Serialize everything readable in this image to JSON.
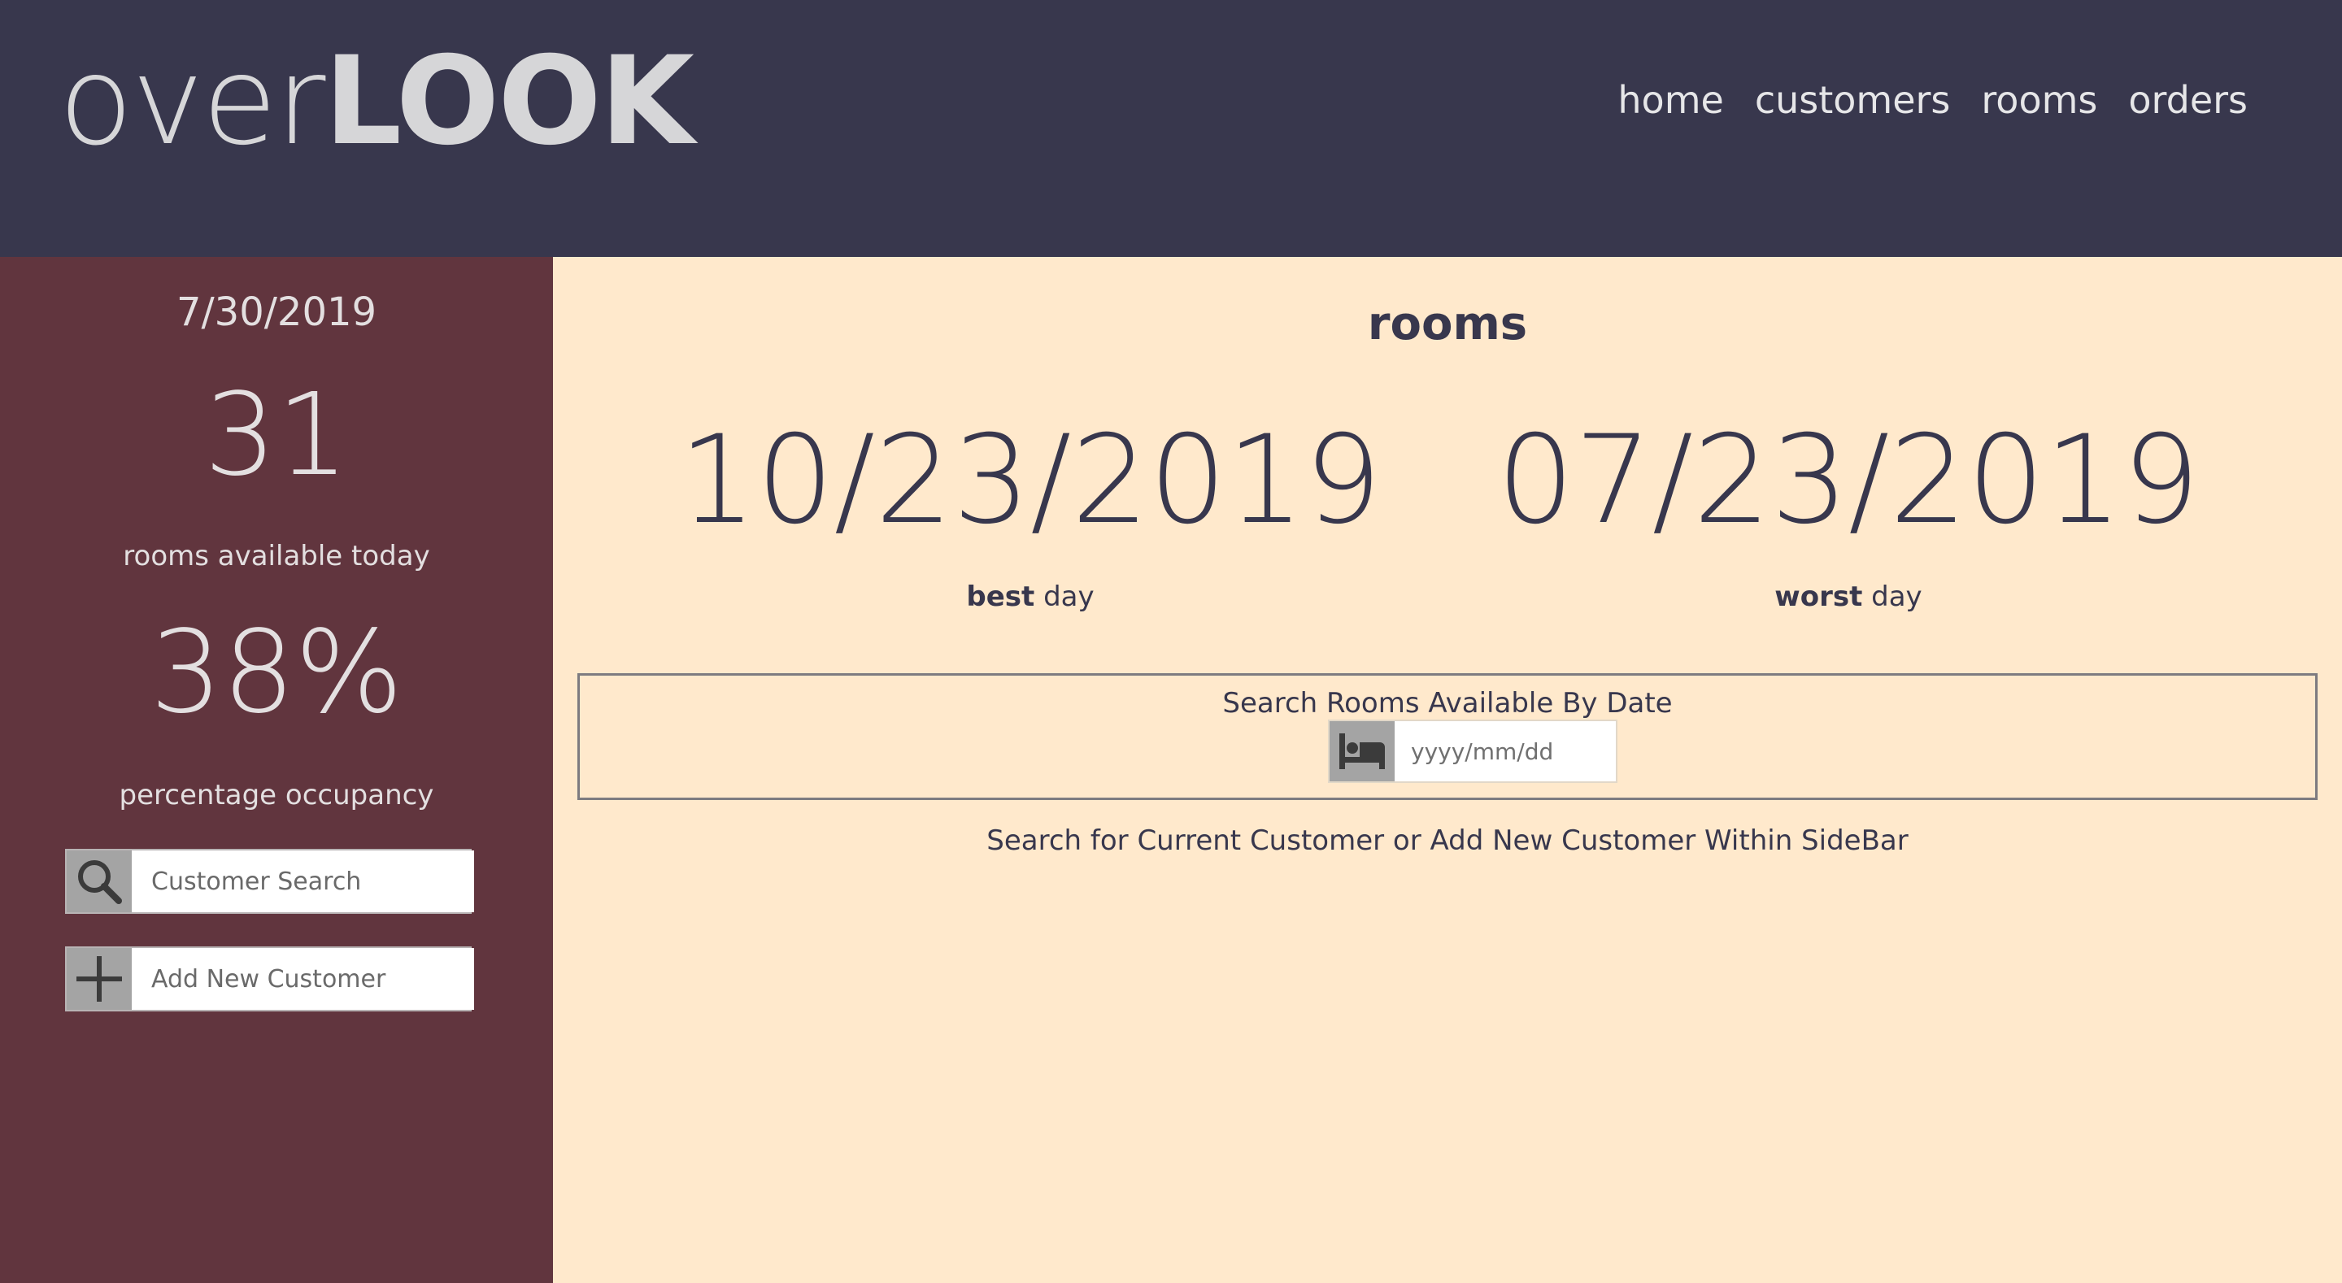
{
  "header": {
    "logo_light": "over",
    "logo_bold": "LOOK",
    "nav": [
      "home",
      "customers",
      "rooms",
      "orders"
    ]
  },
  "sidebar": {
    "date": "7/30/2019",
    "rooms_available": "31",
    "rooms_available_label": "rooms available today",
    "occupancy": "38%",
    "occupancy_label": "percentage occupancy",
    "customer_search": {
      "placeholder": "Customer Search",
      "icon": "search-icon"
    },
    "add_customer": {
      "placeholder": "Add New Customer",
      "icon": "plus-icon"
    }
  },
  "main": {
    "title": "rooms",
    "best": {
      "date": "10/23/2019",
      "strong": "best",
      "suffix": " day"
    },
    "worst": {
      "date": "07/23/2019",
      "strong": "worst",
      "suffix": " day"
    },
    "search": {
      "title": "Search Rooms Available By Date",
      "placeholder": "yyyy/mm/dd",
      "icon": "bed-icon"
    },
    "hint": "Search for Current Customer or Add New Customer Within SideBar"
  },
  "colors": {
    "header_bg": "#38374d",
    "sidebar_bg": "#61353e",
    "main_bg": "#ffe9cc",
    "text_dark": "#38374d",
    "icon_box": "#a4a4a4"
  }
}
